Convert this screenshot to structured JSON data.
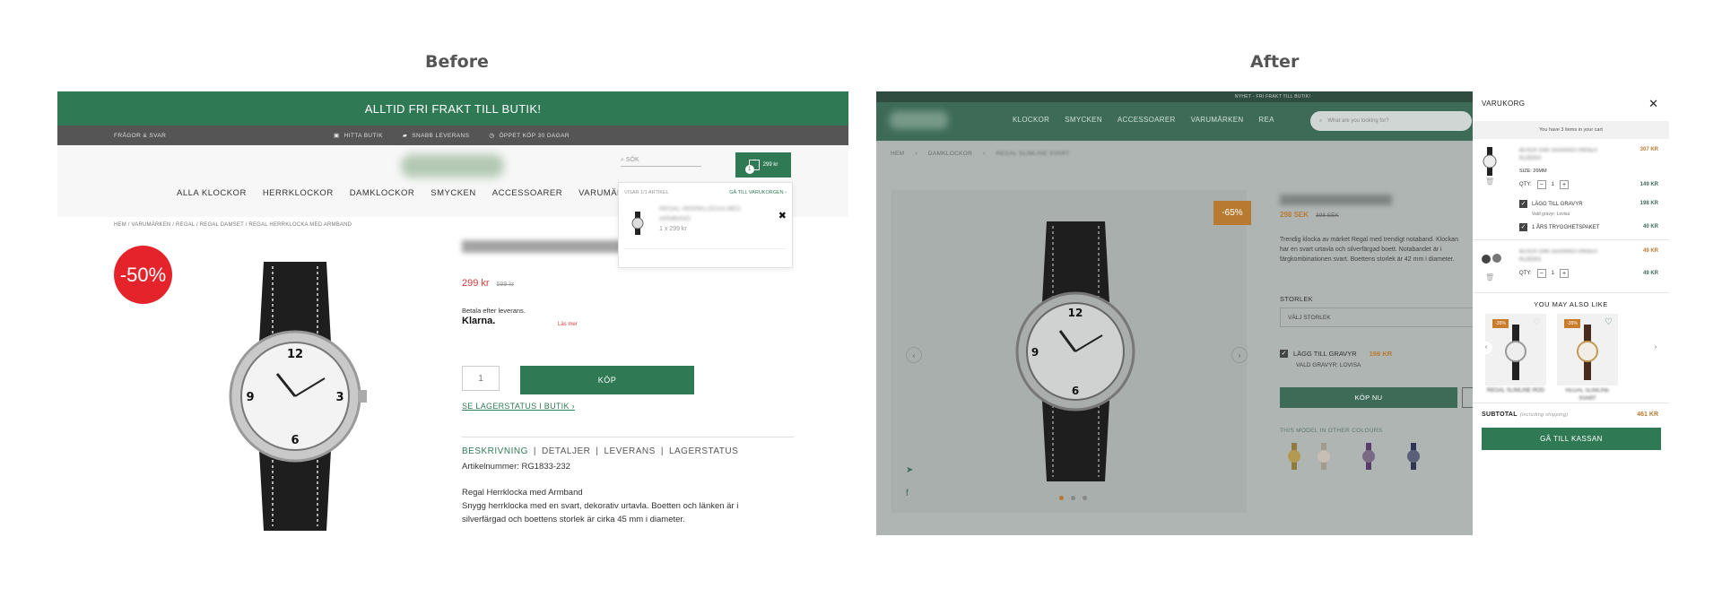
{
  "labels": {
    "before": "Before",
    "after": "After"
  },
  "before": {
    "promo": "ALLTID FRI FRAKT TILL BUTIK!",
    "util": {
      "faq": "FRÅGOR & SVAR",
      "store": "HITTA BUTIK",
      "delivery": "SNABB LEVERANS",
      "returns": "ÖPPET KÖP 30 DAGAR"
    },
    "search_label": "SÖK",
    "cart_amount": "299 kr",
    "cart_count": "1",
    "nav": [
      "ALLA KLOCKOR",
      "HERRKLOCKOR",
      "DAMKLOCKOR",
      "SMYCKEN",
      "ACCESSOARER",
      "VARUMÄRKEN"
    ],
    "breadcrumb": "HEM / VARUMÄRKEN / REGAL / REGAL DAMSET / REGAL HERRKLOCKA MED ARMBAND",
    "sale_badge": "-50%",
    "product_title": "REGAL HERRKLOCKA",
    "price": "299 kr",
    "old_price": "599 kr",
    "pay_after": "Betala efter leverans.",
    "klarna": "Klarna.",
    "read_more": "Läs mer",
    "qty": "1",
    "buy": "KÖP",
    "stock_link": "SE LAGERSTATUS I BUTIK ›",
    "tabs": [
      "BESKRIVNING",
      "DETALJER",
      "LEVERANS",
      "LAGERSTATUS"
    ],
    "article": "Artikelnummer: RG1833-232",
    "desc_title": "Regal Herrklocka med Armband",
    "desc_text": "Snygg herrklocka med en svart, dekorativ urtavla. Boetten och länken är i silverfärgad och boettens storlek är cirka 45 mm i diameter.",
    "mini_cart": {
      "showing": "VISAR 1/1 ARTIKEL",
      "go_cart": "GÅ TILL VARUKORGEN ›",
      "item_name": "REGAL HERRKLOCKA MED ARMBAND",
      "item_qty": "1 x 299 kr"
    }
  },
  "after": {
    "promo": "NYHET - FRI FRAKT TILL BUTIK!",
    "nav": [
      "KLOCKOR",
      "SMYCKEN",
      "ACCESSOARER",
      "VARUMÄRKEN",
      "REA"
    ],
    "search_placeholder": "What are you looking for?",
    "breadcrumb": [
      "HEM",
      "DAMKLOCKOR",
      "REGAL SLIMLINE SVART"
    ],
    "sale_badge": "-65%",
    "product_title": "REGAL SLIMLINE SVART",
    "price": "298 SEK",
    "old_price": "398 SEK",
    "desc": "Trendig klocka av märket Regal med trendigt notaband. Klockan har en svart urtavla och silverfärgad boett. Notabandet är i färgkombinationen svart. Boettens storlek är 42 mm i diameter.",
    "size_label": "STORLEK",
    "size_select": "VÄLJ STORLEK",
    "engrave": "LÄGG TILL GRAVYR",
    "engrave_price": "198 KR",
    "engrave_chosen": "VALD GRAVYR: LOVISA",
    "buy_now": "KÖP NU",
    "other_colours": "THIS MODEL IN OTHER COLOURS",
    "drawer": {
      "title": "VARUKORG",
      "count": "You have 3 items in your cart",
      "item1": {
        "name": "BLACK OAK GERARDI UNISEX KLOCKA",
        "size": "SIZE: 26MM",
        "price": "307 KR",
        "qty_label": "QTY:",
        "qty": "1",
        "qty_price": "149 KR"
      },
      "addon1": {
        "label": "LÄGG TILL GRAVYR",
        "price": "198 KR",
        "sub": "Vald gravyr: Lovisa"
      },
      "addon2": {
        "label": "1 ÅRS TRYGGHETSPAKET",
        "price": "40 KR"
      },
      "item2": {
        "name": "BLACK OAK GERARDI UNISEX KLOCKA",
        "price": "49 KR",
        "qty_label": "QTY:",
        "qty": "1",
        "qty_price": "49 KR"
      },
      "you_may": "YOU MAY ALSO LIKE",
      "rec": [
        {
          "badge": "-35%",
          "name": "REGAL SLIMLINE RÖD"
        },
        {
          "badge": "-35%",
          "name": "REGAL SLIMLINE SVART"
        }
      ],
      "subtotal_label": "SUBTOTAL",
      "subtotal_note": "(including shipping)",
      "subtotal": "461 KR",
      "checkout": "GÅ TILL KASSAN"
    }
  },
  "colors": {
    "green": "#2f7a55",
    "sale_red": "#e4232b",
    "orange": "#b87a31"
  }
}
